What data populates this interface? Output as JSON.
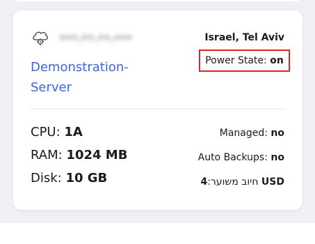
{
  "server": {
    "ip_masked": "•••.••.••.•••",
    "name": "Demonstration-Server",
    "location": "Israel, Tel Aviv",
    "power_label": "Power State:",
    "power_value": "on"
  },
  "specs": {
    "cpu_label": "CPU:",
    "cpu_value": "1A",
    "ram_label": "RAM:",
    "ram_value": "1024 MB",
    "disk_label": "Disk:",
    "disk_value": "10 GB"
  },
  "meta": {
    "managed_label": "Managed:",
    "managed_value": "no",
    "backups_label": "Auto Backups:",
    "backups_value": "no",
    "billing_currency": "USD",
    "billing_label": "חיוב משוער:",
    "billing_value": "4"
  },
  "colors": {
    "accent": "#3d63dd",
    "highlight_border": "#e02323",
    "background": "#eef0f6"
  },
  "icons": {
    "server": "cloud-gear-icon"
  }
}
